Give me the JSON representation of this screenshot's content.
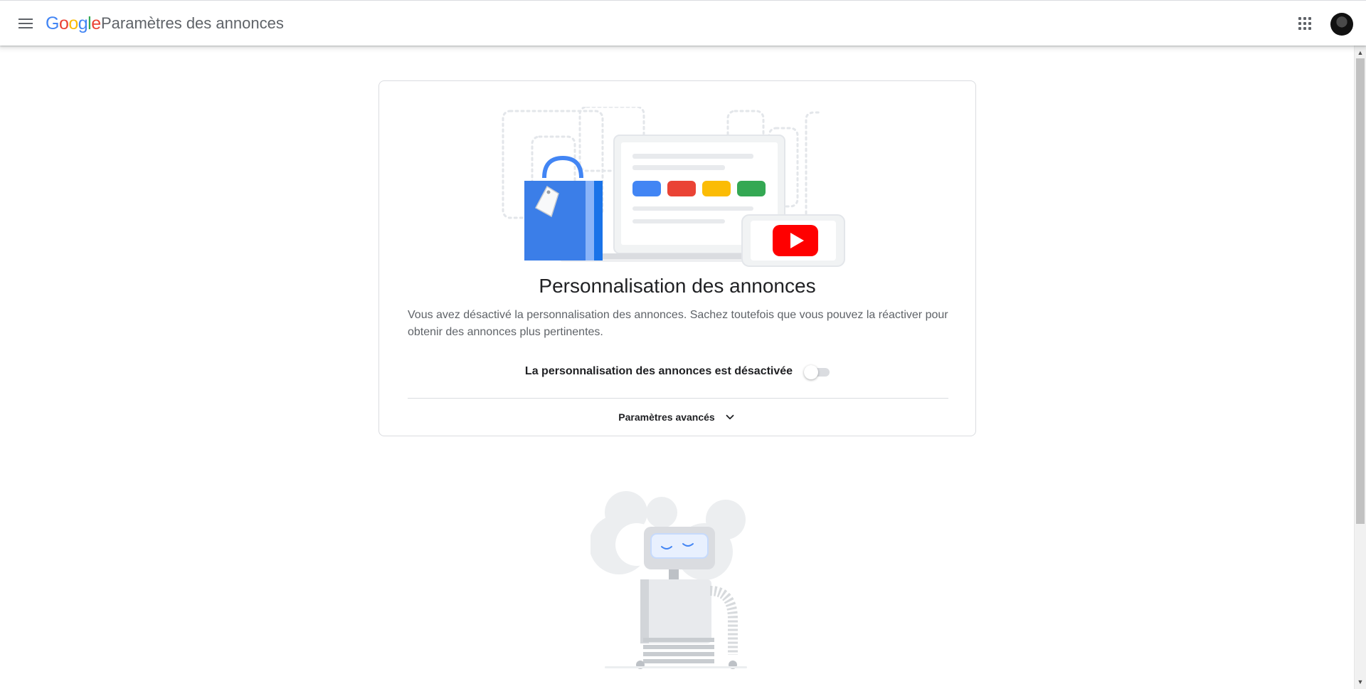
{
  "header": {
    "logo_letters": [
      "G",
      "o",
      "o",
      "g",
      "l",
      "e"
    ],
    "product_title": "Paramètres des annonces",
    "menu_icon": "hamburger-menu-icon",
    "apps_icon": "google-apps-icon",
    "avatar_icon": "account-avatar"
  },
  "card": {
    "title": "Personnalisation des annonces",
    "description": "Vous avez désactivé la personnalisation des annonces. Sachez toutefois que vous pouvez la réactiver pour obtenir des annonces plus pertinentes.",
    "toggle_label": "La personnalisation des annonces est désactivée",
    "toggle_state": "off",
    "advanced_label": "Paramètres avancés"
  },
  "colors": {
    "blue": "#4285f4",
    "red": "#ea4335",
    "yellow": "#fbbc05",
    "green": "#34a853",
    "youtube_red": "#ff0000"
  }
}
